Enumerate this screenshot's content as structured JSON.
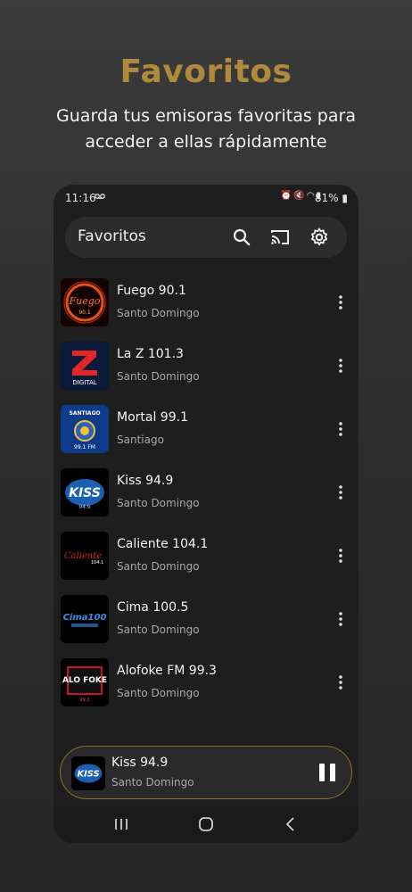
{
  "promo": {
    "title": "Favoritos",
    "subtitle_line1": "Guarda tus emisoras favoritas para",
    "subtitle_line2": "acceder a ellas rápidamente"
  },
  "status_bar": {
    "time": "11:16",
    "voicemail_icon": "voicemail-icon",
    "icons": [
      "alarm-icon",
      "mute-icon",
      "wifi-icon",
      "signal-icon"
    ],
    "battery": "81%"
  },
  "app_bar": {
    "title": "Favoritos",
    "icons": [
      "search-icon",
      "cast-icon",
      "settings-icon"
    ]
  },
  "stations": [
    {
      "name": "Fuego 90.1",
      "city": "Santo Domingo",
      "logo_text": "Fuego"
    },
    {
      "name": "La Z 101.3",
      "city": "Santo Domingo",
      "logo_text": "DIGITAL"
    },
    {
      "name": "Mortal 99.1",
      "city": "Santiago",
      "logo_text": "SANTIAGO"
    },
    {
      "name": "Kiss 94.9",
      "city": "Santo Domingo",
      "logo_text": "KISS"
    },
    {
      "name": "Caliente 104.1",
      "city": "Santo Domingo",
      "logo_text": "Caliente"
    },
    {
      "name": "Cima 100.5",
      "city": "Santo Domingo",
      "logo_text": "Cima100"
    },
    {
      "name": "Alofoke FM 99.3",
      "city": "Santo Domingo",
      "logo_text": "ALO FOKE"
    }
  ],
  "now_playing": {
    "name": "Kiss 94.9",
    "city": "Santo Domingo",
    "control": "pause-icon"
  },
  "nav_bar": [
    "recents-icon",
    "home-icon",
    "back-icon"
  ],
  "colors": {
    "accent": "#b08a3c",
    "background": "#1e1e1e",
    "surface": "#2c2c2c"
  }
}
